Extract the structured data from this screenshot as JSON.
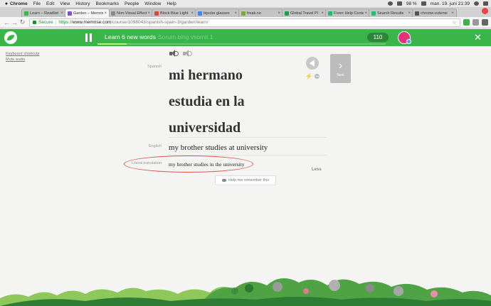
{
  "menubar": {
    "app": "Chrome",
    "items": [
      "File",
      "Edit",
      "View",
      "History",
      "Bookmarks",
      "People",
      "Window",
      "Help"
    ],
    "battery": "98 %",
    "clock": "man. 19. juni  21:39"
  },
  "tabs": [
    {
      "title": "Learn – Readlist",
      "color": "#3ab54a"
    },
    {
      "title": "Garden – Memrise",
      "color": "#7b57c4",
      "active": true
    },
    {
      "title": "Non-Visual Effects",
      "color": "#888888"
    },
    {
      "title": "Block Blue Light",
      "color": "#d44a3a"
    },
    {
      "title": "bipolar glasses",
      "color": "#4285f4"
    },
    {
      "title": "freak.no",
      "color": "#7aa83a"
    },
    {
      "title": "Global Travel Pl",
      "color": "#1aa04a"
    },
    {
      "title": "Fiverr Help Cente",
      "color": "#1dbf73"
    },
    {
      "title": "Search Results",
      "color": "#1dbf73"
    },
    {
      "title": "chrome-extensi",
      "color": "#555555"
    }
  ],
  "address": {
    "secure_label": "Secure",
    "scheme": "https://",
    "host": "www.memrise.com",
    "path": "/course/1098043/spanish-spain-3/garden/learn/"
  },
  "session": {
    "title": "Learn 6 new words",
    "ghost_text": "Sorum bing vsomit 1",
    "progress": 0.1,
    "points": "110",
    "colors": {
      "brand": "#3ab54a",
      "avatar": "#e3317b"
    }
  },
  "left_links": {
    "shortcuts": "Keyboard shortcuts",
    "mute": "Mute audio"
  },
  "card": {
    "spanish_label": "Spanish",
    "spanish_lines": [
      "mi hermano",
      "estudia en la",
      "universidad"
    ],
    "english_label": "English",
    "english": "my brother studies at university",
    "literal_label": "Literal translation",
    "literal": "my brother studies in the university",
    "less": "Less",
    "help": "Help me remember this",
    "next": "Next"
  }
}
